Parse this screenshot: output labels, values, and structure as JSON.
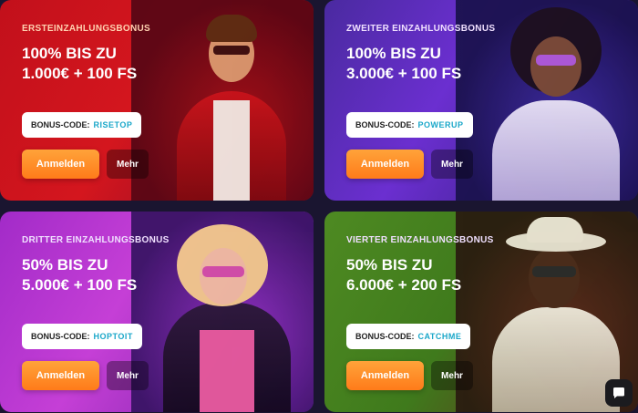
{
  "cards": [
    {
      "label": "ERSTEINZAHLUNGSBONUS",
      "title_line1": "100% BIS ZU",
      "title_line2": "1.000€ + 100 FS",
      "code_prefix": "BONUS-CODE:",
      "code": "RISETOP",
      "primary_button": "Anmelden",
      "secondary_button": "Mehr"
    },
    {
      "label": "ZWEITER EINZAHLUNGSBONUS",
      "title_line1": "100% BIS ZU",
      "title_line2": "3.000€ + 100 FS",
      "code_prefix": "BONUS-CODE:",
      "code": "POWERUP",
      "primary_button": "Anmelden",
      "secondary_button": "Mehr"
    },
    {
      "label": "DRITTER EINZAHLUNGSBONUS",
      "title_line1": "50% BIS ZU",
      "title_line2": "5.000€ + 100 FS",
      "code_prefix": "BONUS-CODE:",
      "code": "HOPTOIT",
      "primary_button": "Anmelden",
      "secondary_button": "Mehr"
    },
    {
      "label": "VIERTER EINZAHLUNGSBONUS",
      "title_line1": "50% BIS ZU",
      "title_line2": "6.000€ + 200 FS",
      "code_prefix": "BONUS-CODE:",
      "code": "CATCHME",
      "primary_button": "Anmelden",
      "secondary_button": "Mehr"
    }
  ],
  "icons": {
    "chat": "chat-bubble-icon"
  },
  "colors": {
    "primary_button": "#ff8a20",
    "code_text": "#1aa7c9",
    "card1": "#d4161e",
    "card2": "#6b2fd0",
    "card3": "#c53fd6",
    "card4": "#4e8a22"
  }
}
